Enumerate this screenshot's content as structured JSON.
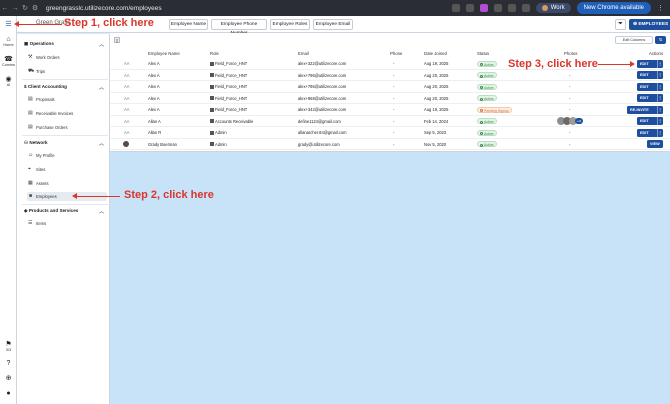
{
  "browser": {
    "url": "greengrasslc.utilizecore.com/employees",
    "profile_label": "Work",
    "update_button": "New Chrome available",
    "update_more": "⋮"
  },
  "rail": {
    "items": [
      {
        "label": "Home",
        "glyph": "⌂"
      },
      {
        "label": "Comms",
        "glyph": "☎"
      },
      {
        "label": "AI",
        "glyph": "◉"
      },
      {
        "label": "3/3",
        "glyph": "⚑"
      },
      {
        "label": "",
        "glyph": "?"
      },
      {
        "label": "",
        "glyph": "⊕"
      },
      {
        "label": "",
        "glyph": "●"
      }
    ]
  },
  "topbar": {
    "brand": "Green Grass",
    "tabs": [
      "Employee Name",
      "Employee Phone Number",
      "Employee Roles",
      "Employee Email"
    ],
    "employees_button": "EMPLOYEES"
  },
  "sidebar": {
    "sections": [
      {
        "title": "Operations",
        "items": [
          "Work Orders",
          "Trips"
        ]
      },
      {
        "title": "Client Accounting",
        "items": [
          "Proposals",
          "Receivable Invoices",
          "Purchase Orders"
        ]
      },
      {
        "title": "Network",
        "items": [
          "My Profile",
          "Sites",
          "Assets",
          "Employees"
        ]
      },
      {
        "title": "Products and Services",
        "items": [
          "Items"
        ]
      }
    ]
  },
  "table": {
    "edit_columns": "Edit Columns",
    "headers": [
      "Employee Name",
      "Role",
      "Email",
      "Phone",
      "Date Joined",
      "Status",
      "Photos",
      "Actions"
    ],
    "rows": [
      {
        "initials": "AA",
        "name": "Alex A",
        "role": "Field_Force_HNT",
        "email": "alex+322@utilizecore.com",
        "phone": "-",
        "date": "Aug 19, 2025",
        "status": "Active",
        "photos": "-",
        "action": "EDIT"
      },
      {
        "initials": "AA",
        "name": "Alex A",
        "role": "Field_Force_HNT",
        "email": "alex+796@utilizecore.com",
        "phone": "-",
        "date": "Aug 20, 2025",
        "status": "Active",
        "photos": "-",
        "action": "EDIT"
      },
      {
        "initials": "AA",
        "name": "Alex A",
        "role": "Field_Force_HNT",
        "email": "alex+786@utilizecore.com",
        "phone": "-",
        "date": "Aug 20, 2025",
        "status": "Active",
        "photos": "-",
        "action": "EDIT"
      },
      {
        "initials": "AA",
        "name": "Alex A",
        "role": "Field_Force_HNT",
        "email": "alex+968@utilizecore.com",
        "phone": "-",
        "date": "Aug 20, 2025",
        "status": "Active",
        "photos": "-",
        "action": "EDIT"
      },
      {
        "initials": "AA",
        "name": "Alex A",
        "role": "Field_Force_HNT",
        "email": "alex+342@utilizecore.com",
        "phone": "-",
        "date": "Aug 19, 2025",
        "status": "Pending Signup",
        "photos": "-",
        "action": "RE-INVITE"
      },
      {
        "initials": "AA",
        "name": "Allan A",
        "role": "Accounts Receivable",
        "email": "define1124@gmail.com",
        "phone": "-",
        "date": "Feb 14, 2024",
        "status": "Active",
        "photos": "+11",
        "action": "EDIT"
      },
      {
        "initials": "AA",
        "name": "Allan R",
        "role": "Admin",
        "email": "allanarcher.84@gmail.com",
        "phone": "-",
        "date": "Sep 5, 2023",
        "status": "Active",
        "photos": "-",
        "action": "EDIT"
      },
      {
        "initials": "",
        "name": "Grady Boerman",
        "role": "Admin",
        "email": "grady@utilizecore.com",
        "phone": "-",
        "date": "Nov 5, 2020",
        "status": "Active",
        "photos": "-",
        "action": "VIEW"
      }
    ]
  },
  "annotations": {
    "step1": "Step 1, click here",
    "step2": "Step 2, click here",
    "step3": "Step 3, click here"
  },
  "colors": {
    "primary": "#1d4f9e",
    "annotation": "#d9362c",
    "content_bg": "#c8e2f8",
    "active_green": "#3a8a4a",
    "pending_orange": "#d2763a"
  }
}
